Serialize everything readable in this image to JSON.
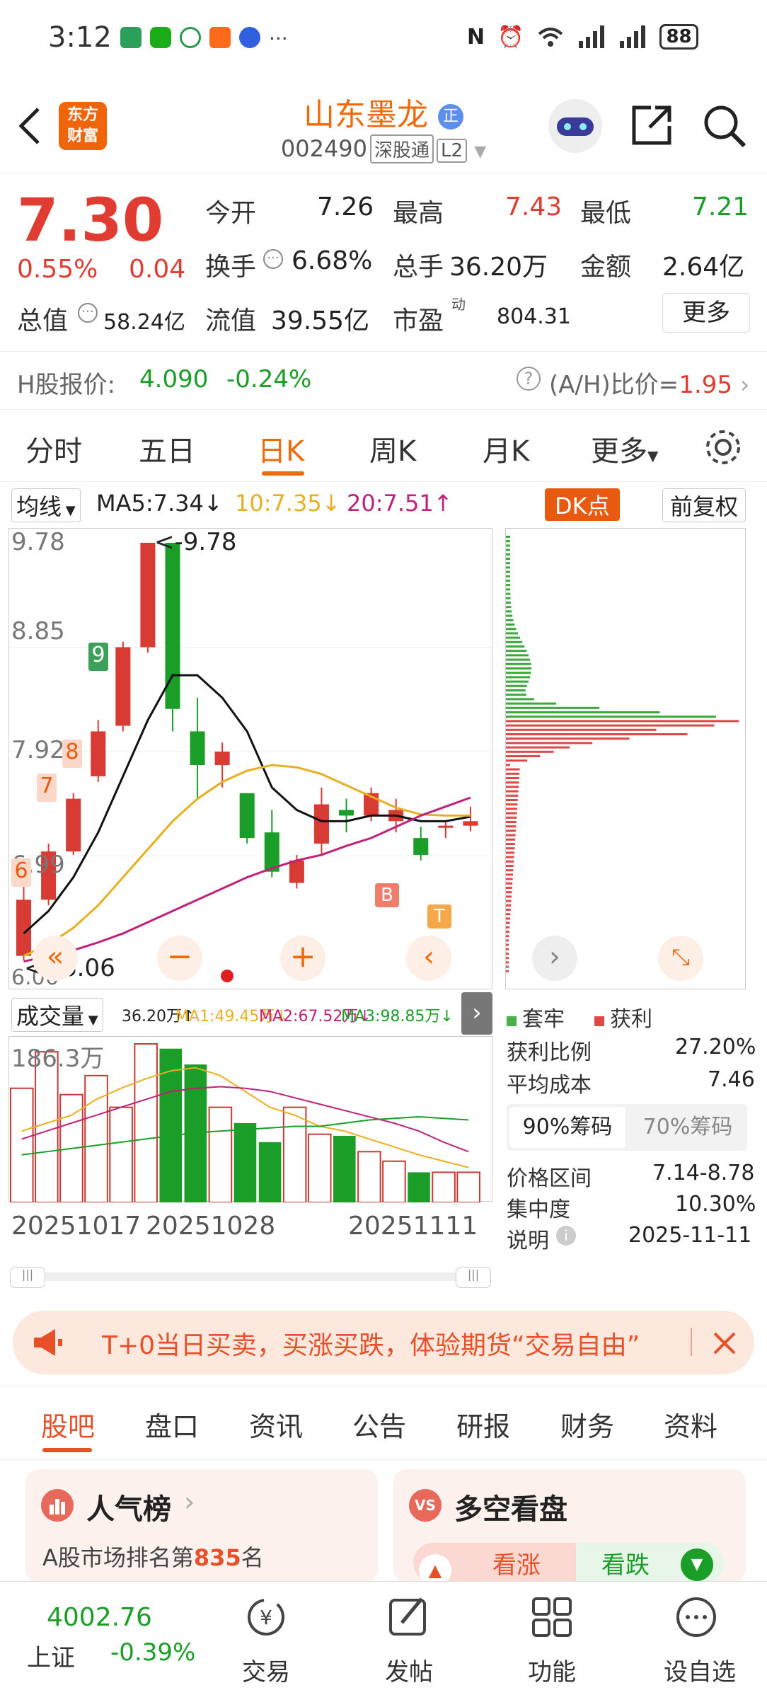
{
  "status": {
    "time": "3:12",
    "battery": "88"
  },
  "header": {
    "logo": "东方财富",
    "name": "山东墨龙",
    "zheng_badge": "正",
    "code": "002490",
    "tag1": "深股通",
    "tag2": "L2"
  },
  "quote": {
    "price": "7.30",
    "pct": "0.55%",
    "chg": "0.04",
    "labels": {
      "open": "今开",
      "high": "最高",
      "low": "最低",
      "turnover": "换手",
      "vol": "总手",
      "amount": "金额",
      "mktcap": "总值",
      "float": "流值",
      "pe": "市盈",
      "pe_sup": "动"
    },
    "open": "7.26",
    "high": "7.43",
    "low": "7.21",
    "turnover": "6.68%",
    "vol": "36.20万",
    "amount": "2.64亿",
    "mktcap": "58.24亿",
    "float": "39.55亿",
    "pe": "804.31",
    "more": "更多"
  },
  "hshare": {
    "label": "H股报价:",
    "price": "4.090",
    "chg": "-0.24%",
    "ratio_label": "(A/H)比价=",
    "ratio": "1.95"
  },
  "tabs": [
    "分时",
    "五日",
    "日K",
    "周K",
    "月K",
    "更多"
  ],
  "active_tab": "日K",
  "ma_bar": {
    "mode": "均线",
    "ma5": "MA5:7.34",
    "ma10": "10:7.35",
    "ma20": "20:7.51",
    "dk": "DK点",
    "fq": "前复权"
  },
  "kchart": {
    "y_labels": [
      "9.78",
      "8.85",
      "7.92",
      "6.99",
      "6.06"
    ],
    "high_mark": "<-9.78",
    "low_mark": "<--6.06",
    "markers": [
      "9",
      "8",
      "7",
      "6",
      "B",
      "T"
    ]
  },
  "chart_data": {
    "type": "candlestick",
    "dates": [
      "20251017",
      "20251028",
      "20251111"
    ],
    "candles": [
      [
        6.1,
        6.6,
        6.06,
        6.8
      ],
      [
        6.6,
        7.03,
        6.55,
        7.1
      ],
      [
        7.03,
        7.5,
        7.0,
        7.55
      ],
      [
        7.7,
        8.1,
        7.65,
        8.2
      ],
      [
        8.15,
        8.85,
        8.1,
        8.9
      ],
      [
        8.85,
        9.78,
        8.8,
        9.78
      ],
      [
        9.78,
        8.3,
        8.1,
        9.78
      ],
      [
        8.1,
        7.8,
        7.5,
        8.4
      ],
      [
        7.8,
        7.92,
        7.6,
        8.0
      ],
      [
        7.55,
        7.15,
        7.1,
        7.55
      ],
      [
        7.2,
        6.85,
        6.8,
        7.4
      ],
      [
        6.75,
        6.95,
        6.7,
        7.0
      ],
      [
        7.1,
        7.45,
        7.0,
        7.6
      ],
      [
        7.4,
        7.35,
        7.2,
        7.5
      ],
      [
        7.35,
        7.55,
        7.3,
        7.6
      ],
      [
        7.3,
        7.4,
        7.2,
        7.5
      ],
      [
        7.15,
        7.0,
        6.95,
        7.25
      ],
      [
        7.25,
        7.26,
        7.15,
        7.3
      ],
      [
        7.26,
        7.3,
        7.21,
        7.43
      ]
    ],
    "ma5": [
      6.3,
      6.5,
      6.8,
      7.2,
      7.7,
      8.2,
      8.6,
      8.6,
      8.4,
      8.1,
      7.6,
      7.4,
      7.3,
      7.3,
      7.35,
      7.35,
      7.3,
      7.3,
      7.34
    ],
    "ma10": [
      6.1,
      6.2,
      6.35,
      6.55,
      6.8,
      7.05,
      7.3,
      7.5,
      7.65,
      7.75,
      7.8,
      7.78,
      7.72,
      7.62,
      7.52,
      7.42,
      7.36,
      7.35,
      7.35
    ],
    "ma20": [
      6.05,
      6.1,
      6.15,
      6.22,
      6.3,
      6.4,
      6.5,
      6.6,
      6.7,
      6.8,
      6.88,
      6.95,
      7.0,
      7.08,
      7.15,
      7.25,
      7.35,
      7.43,
      7.51
    ],
    "volume_max": "186.3万"
  },
  "chips": {
    "legend_trap": "套牢",
    "legend_profit": "获利",
    "profit_label": "获利比例",
    "profit": "27.20%",
    "cost_label": "平均成本",
    "cost": "7.46",
    "tab90": "90%筹码",
    "tab70": "70%筹码",
    "range_label": "价格区间",
    "range": "7.14-8.78",
    "conc_label": "集中度",
    "conc": "10.30%",
    "note_label": "说明",
    "note_date": "2025-11-11"
  },
  "volbar": {
    "title": "成交量",
    "v": "36.20万↑",
    "ma1": "MA1:49.45万↓",
    "ma2": "MA2:67.52万↓",
    "ma3": "MA3:98.85万↓",
    "max": "186.3万"
  },
  "ad": {
    "text": "T+0当日买卖，买涨买跌，体验期货“交易自由”"
  },
  "subtabs": [
    "股吧",
    "盘口",
    "资讯",
    "公告",
    "研报",
    "财务",
    "资料"
  ],
  "cards": {
    "popular": "人气榜",
    "rank_prefix": "A股市场排名第",
    "rank": "835",
    "rank_suffix": "名",
    "duokong": "多空看盘",
    "up": "看涨",
    "down": "看跌",
    "vs": "VS"
  },
  "bottom": {
    "index_val": "4002.76",
    "index_name": "上证",
    "index_chg": "-0.39%",
    "nav": [
      "交易",
      "发帖",
      "功能",
      "设自选"
    ]
  }
}
